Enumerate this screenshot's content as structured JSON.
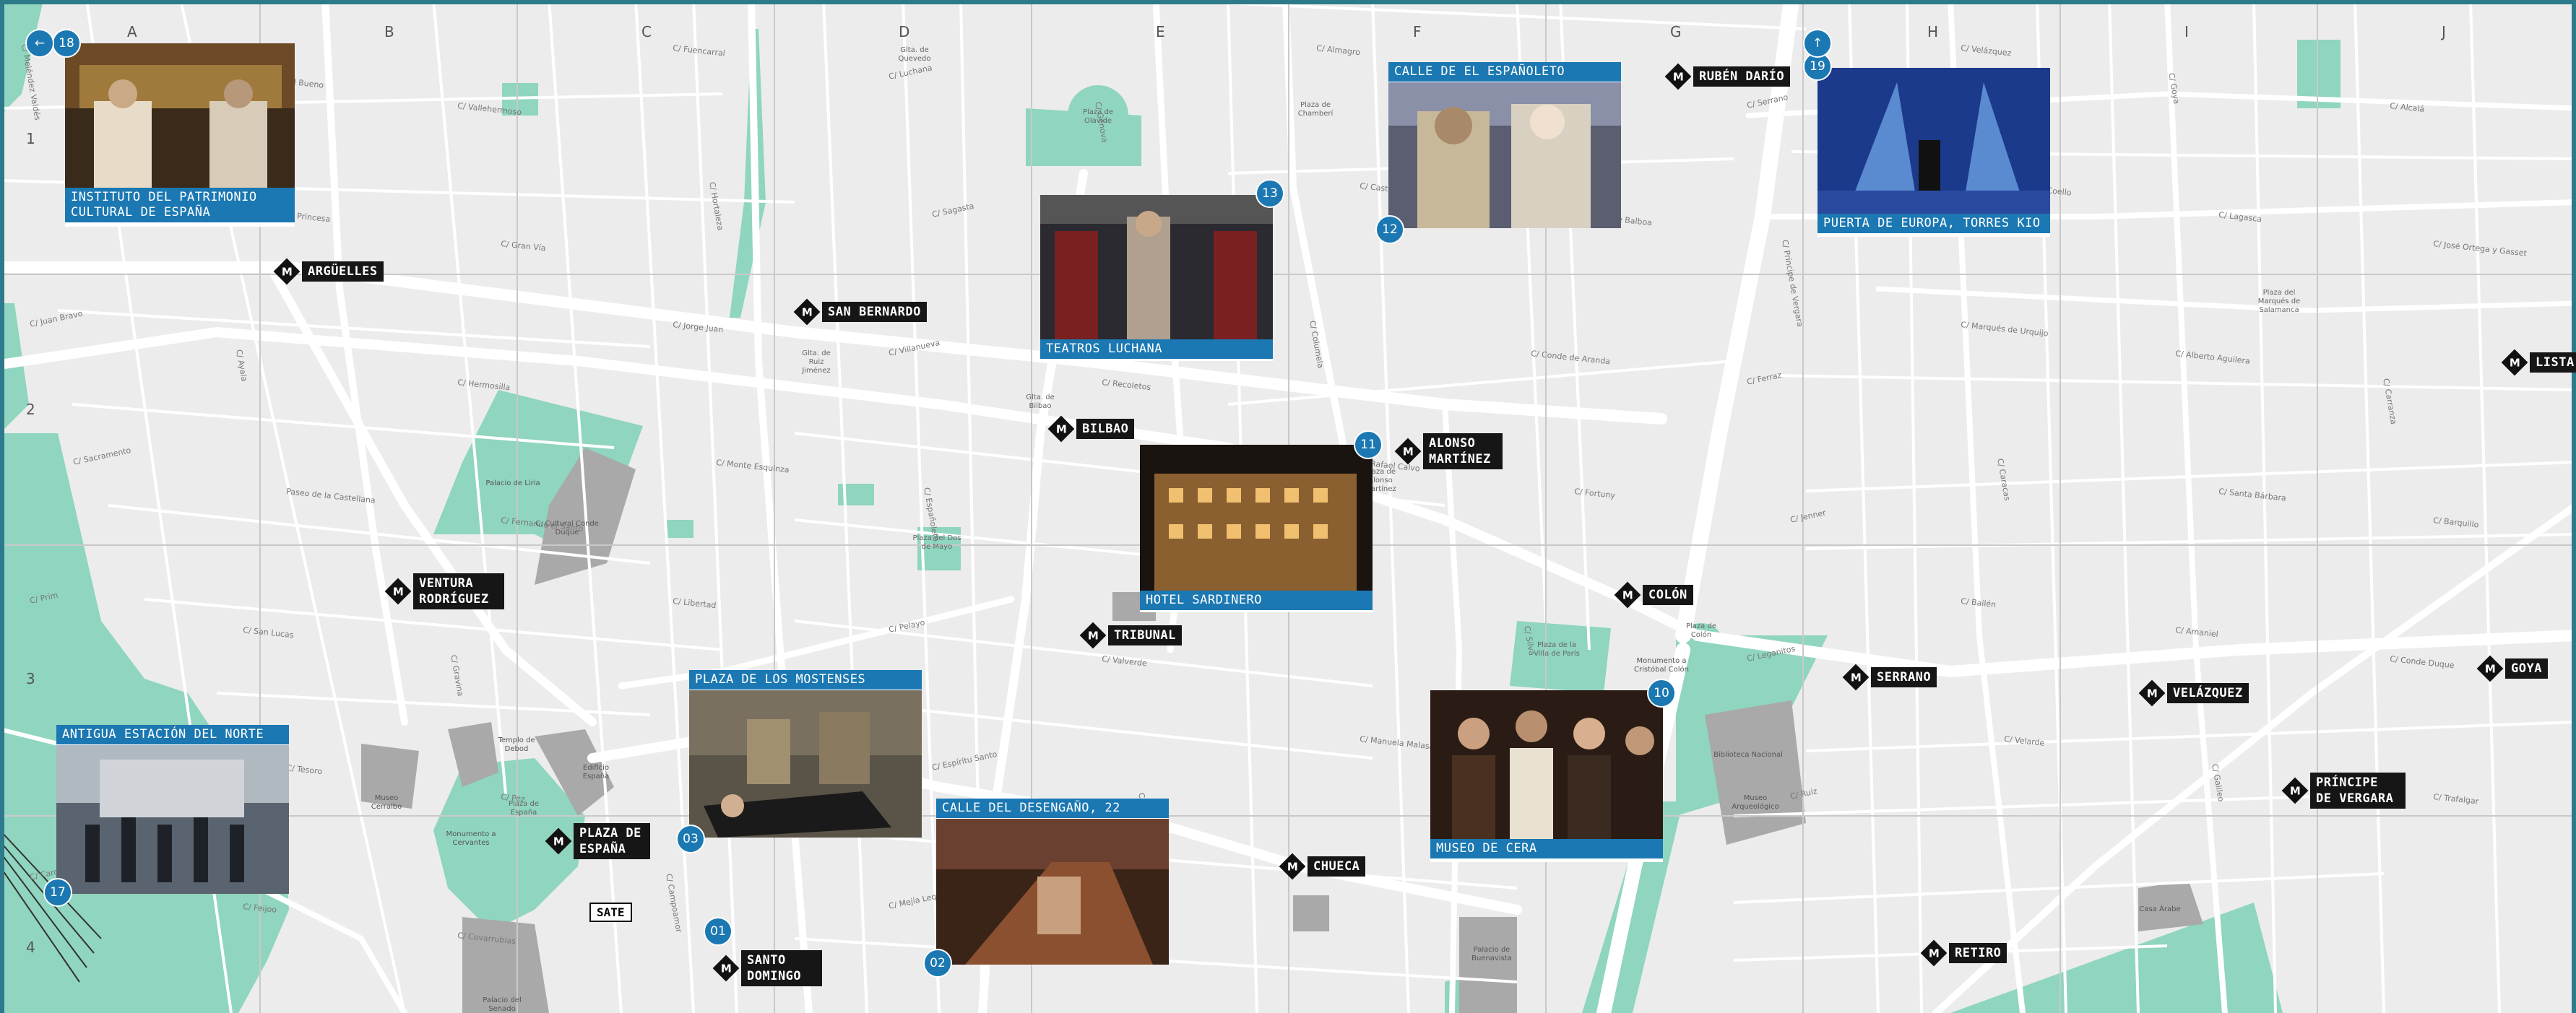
{
  "grid": {
    "columns": [
      "A",
      "B",
      "C",
      "D",
      "E",
      "F",
      "G",
      "H",
      "I",
      "J"
    ],
    "rows": [
      "1",
      "2",
      "3",
      "4"
    ]
  },
  "markers": [
    {
      "number": "18",
      "caption": "INSTITUTO DEL PATRIMONIO CULTURAL DE ESPAÑA"
    },
    {
      "number": "12",
      "caption": "CALLE DE EL ESPAÑOLETO"
    },
    {
      "number": "13",
      "caption": "TEATROS LUCHANA"
    },
    {
      "number": "19",
      "caption": "PUERTA DE EUROPA, TORRES KIO"
    },
    {
      "number": "11",
      "caption": "HOTEL SARDINERO"
    },
    {
      "number": "10",
      "caption": "MUSEO DE CERA"
    },
    {
      "number": "03",
      "caption": "PLAZA DE LOS MOSTENSES"
    },
    {
      "number": "02",
      "caption": "CALLE DEL DESENGAÑO, 22"
    },
    {
      "number": "17",
      "caption": "ANTIGUA ESTACIÓN DEL NORTE"
    },
    {
      "number": "01",
      "caption": ""
    }
  ],
  "metro_stations": [
    {
      "symbol": "M",
      "name": "ARGÜELLES"
    },
    {
      "symbol": "M",
      "name": "SAN BERNARDO"
    },
    {
      "symbol": "M",
      "name": "BILBAO"
    },
    {
      "symbol": "M",
      "name": "ALONSO MARTÍNEZ"
    },
    {
      "symbol": "M",
      "name": "RUBÉN DARÍO"
    },
    {
      "symbol": "M",
      "name": "VENTURA RODRÍGUEZ"
    },
    {
      "symbol": "M",
      "name": "TRIBUNAL"
    },
    {
      "symbol": "M",
      "name": "COLÓN"
    },
    {
      "symbol": "M",
      "name": "SERRANO"
    },
    {
      "symbol": "M",
      "name": "VELÁZQUEZ"
    },
    {
      "symbol": "M",
      "name": "GOYA"
    },
    {
      "symbol": "M",
      "name": "LISTA"
    },
    {
      "symbol": "M",
      "name": "PLAZA DE ESPAÑA"
    },
    {
      "symbol": "M",
      "name": "CHUECA"
    },
    {
      "symbol": "M",
      "name": "PRÍNCIPE DE VERGARA"
    },
    {
      "symbol": "M",
      "name": "SANTO DOMINGO"
    },
    {
      "symbol": "M",
      "name": "RETIRO"
    }
  ],
  "misc": {
    "sate": "SATE"
  },
  "plazas": [
    "Plaza de Olavide",
    "Glta. de Quevedo",
    "Plaza de Chamberí",
    "Glta. de Ruiz Jiménez",
    "Glta. de Bilbao",
    "Plaza de Alonso Martínez",
    "Plaza del Dos de Mayo",
    "Plaza de Colón",
    "Plaza de la Villa de París",
    "Plaza de España",
    "Plaza del Marqués de Salamanca"
  ],
  "buildings": [
    "Palacio de Liria",
    "C. Cultural Conde Duque",
    "Templo de Debod",
    "Edificio España",
    "Museo Cerralbo",
    "Monumento a Cervantes",
    "Biblioteca Nacional",
    "Museo Arqueológico",
    "Monumento a Cristóbal Colón",
    "Palacio del Senado",
    "Palacio de Buenavista",
    "Casa Árabe"
  ],
  "streets": [
    "C/ Meléndez Valdés",
    "C/ Guzmán el Bueno",
    "C/ Vallehermoso",
    "C/ Fuencarral",
    "C/ Luchana",
    "C/ Génova",
    "C/ Almagro",
    "C/ Zurbano",
    "C/ Serrano",
    "C/ Velázquez",
    "C/ Goya",
    "C/ Alcalá",
    "C/ San Bernardo",
    "C/ Princesa",
    "C/ Gran Vía",
    "C/ Hortaleza",
    "C/ Sagasta",
    "C/ Santa Engracia",
    "C/ Castelló",
    "C/ Núñez de Balboa",
    "C/ Príncipe de Vergara",
    "C/ Claudio Coello",
    "C/ Lagasca",
    "C/ José Ortega y Gasset",
    "C/ Juan Bravo",
    "C/ Ayala",
    "C/ Hermosilla",
    "C/ Jorge Juan",
    "C/ Villanueva",
    "C/ Recoletos",
    "C/ Columela",
    "C/ Conde de Aranda",
    "C/ Ferraz",
    "C/ Marqués de Urquijo",
    "C/ Alberto Aguilera",
    "C/ Carranza",
    "C/ Sacramento",
    "Paseo de la Castellana",
    "C/ Fernando el Santo",
    "C/ Monte Esquinza",
    "C/ Españoleto",
    "C/ Eduardo Dato",
    "C/ Rafael Calvo",
    "C/ Fortuny",
    "C/ Jenner",
    "C/ Caracas",
    "C/ Santa Bárbara",
    "C/ Barquillo",
    "C/ Prim",
    "C/ San Lucas",
    "C/ Gravina",
    "C/ Libertad",
    "C/ Pelayo",
    "C/ Valverde",
    "C/ Desengaño",
    "C/ Silva",
    "C/ Leganitos",
    "C/ Bailén",
    "C/ Amaniel",
    "C/ Conde Duque",
    "C/ Noviciado",
    "C/ Tesoro",
    "C/ Pez",
    "C/ Palma",
    "C/ Espíritu Santo",
    "C/ San Vicente Ferrer",
    "C/ Manuela Malasaña",
    "C/ Divino Pastor",
    "C/ Ruiz",
    "C/ Velarde",
    "C/ Galileo",
    "C/ Trafalgar",
    "C/ Cardenal Cisneros",
    "C/ Feijoo",
    "C/ Covarrubias",
    "C/ Campoamor",
    "C/ Mejía Lequerica"
  ],
  "colors": {
    "background": "#ececec",
    "road": "#ffffff",
    "park": "#8fd5bf",
    "building": "#a9a9a9",
    "gridline": "#cfcfcf",
    "caption": "#1b78b2",
    "metro": "#161616"
  }
}
